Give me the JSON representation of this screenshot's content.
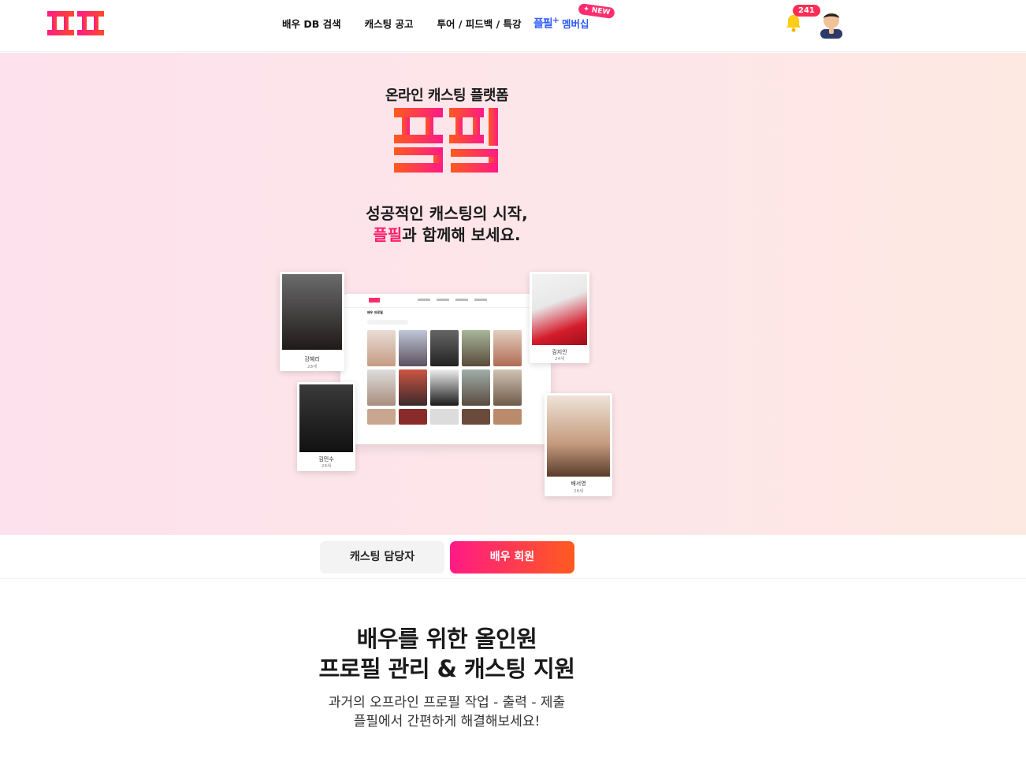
{
  "header": {
    "nav": [
      "배우 DB 검색",
      "캐스팅 공고",
      "투어 / 피드백 / 특강"
    ],
    "membership_label": "멤버십",
    "membership_mark": "플필",
    "new_badge": "✦ NEW",
    "notification_count": "241"
  },
  "hero": {
    "subtitle": "온라인 캐스팅 플랫폼",
    "logo_text": "플필",
    "tagline_line1": "성공적인 캐스팅의 시작,",
    "tagline_highlight": "플필",
    "tagline_line2_rest": "과 함께해 보세요.",
    "mockup_title": "배우 프로필",
    "cards": [
      {
        "name": "강혜리",
        "age": "28세"
      },
      {
        "name": "김지안",
        "age": "24세"
      },
      {
        "name": "김민수",
        "age": "28세"
      },
      {
        "name": "배서영",
        "age": "28세"
      }
    ]
  },
  "tabs": {
    "casting_manager": "캐스팅 담당자",
    "actor_member": "배우 회원",
    "active": "배우 회원"
  },
  "section": {
    "title_line1": "배우를 위한 올인원",
    "title_line2": "프로필 관리 & 캐스팅 지원",
    "desc_line1": "과거의 오프라인 프로필 작업 - 출력 - 제출",
    "desc_line2": "플필에서 간편하게 해결해보세요!"
  },
  "colors": {
    "accent_pink": "#ff1f6b",
    "accent_orange": "#ff5a1e",
    "membership_blue": "#2f5bff"
  }
}
